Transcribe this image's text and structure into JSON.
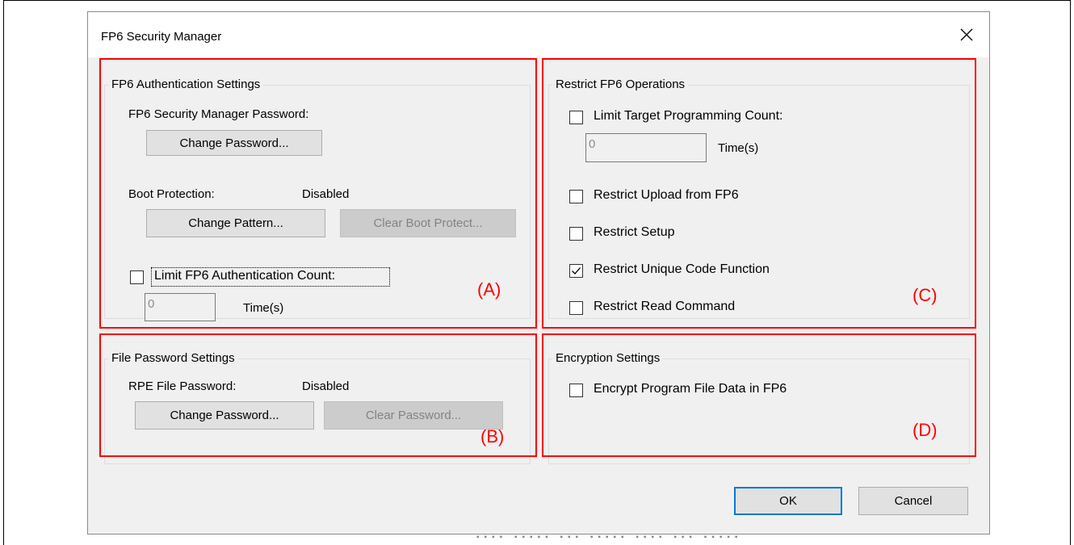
{
  "dialog": {
    "title": "FP6 Security Manager"
  },
  "auth_settings": {
    "legend": "FP6 Authentication Settings",
    "password_label": "FP6 Security Manager Password:",
    "change_password_button": "Change Password...",
    "boot_protection_label": "Boot Protection:",
    "boot_protection_status": "Disabled",
    "change_pattern_button": "Change Pattern...",
    "clear_boot_protect_button": "Clear Boot Protect...",
    "limit_auth_count": {
      "label": "Limit FP6 Authentication Count:",
      "checked": false
    },
    "auth_count_value": "0",
    "auth_count_unit": "Time(s)"
  },
  "file_password_settings": {
    "legend": "File Password Settings",
    "rpe_label": "RPE File Password:",
    "rpe_status": "Disabled",
    "change_password_button": "Change Password...",
    "clear_password_button": "Clear Password..."
  },
  "restrict_operations": {
    "legend": "Restrict FP6 Operations",
    "limit_programming_count": {
      "label": "Limit Target Programming Count:",
      "checked": false
    },
    "programming_count_value": "0",
    "programming_count_unit": "Time(s)",
    "restrict_upload": {
      "label": "Restrict Upload from FP6",
      "checked": false
    },
    "restrict_setup": {
      "label": "Restrict Setup",
      "checked": false
    },
    "restrict_unique_code": {
      "label": "Restrict Unique Code Function",
      "checked": true
    },
    "restrict_read": {
      "label": "Restrict Read Command",
      "checked": false
    }
  },
  "encryption_settings": {
    "legend": "Encryption Settings",
    "encrypt_data": {
      "label": "Encrypt Program File Data in FP6",
      "checked": false
    }
  },
  "footer": {
    "ok_button": "OK",
    "cancel_button": "Cancel"
  },
  "annotations": {
    "a": "(A)",
    "b": "(B)",
    "c": "(C)",
    "d": "(D)"
  },
  "colors": {
    "annotation": "#ff0000",
    "default_button_border": "#0078d7",
    "dialog_bg": "#f0f0f0"
  }
}
